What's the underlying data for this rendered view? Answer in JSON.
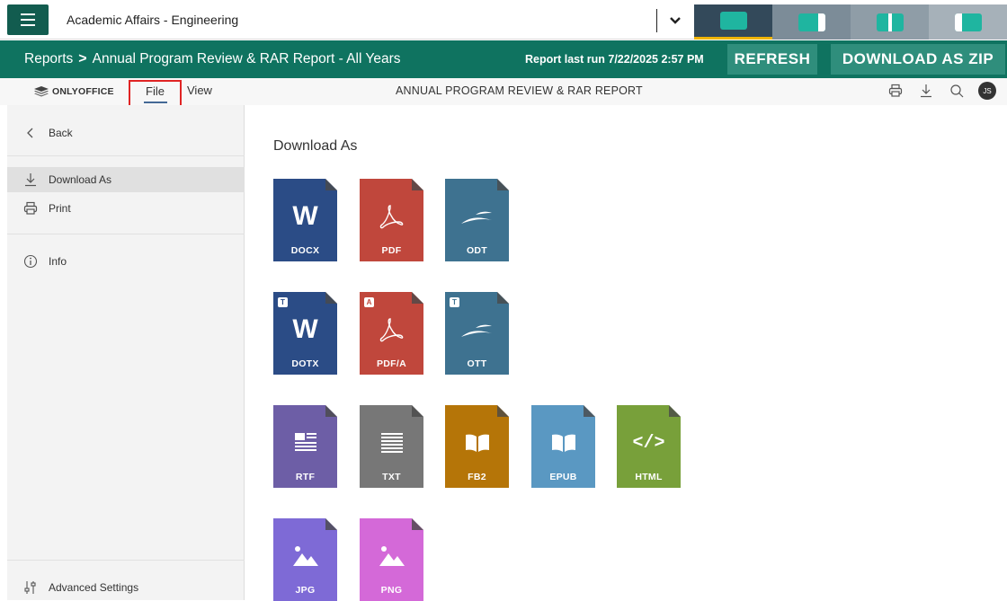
{
  "topbar": {
    "org_name": "Academic Affairs - Engineering",
    "dropdown_icon": "chevron-down-icon",
    "layout_tabs": [
      "layout-full-icon",
      "layout-split-1-icon",
      "layout-split-2-icon",
      "layout-split-3-icon"
    ]
  },
  "reportbar": {
    "breadcrumb_root": "Reports",
    "breadcrumb_separator": ">",
    "breadcrumb_current": "Annual Program Review & RAR Report - All Years",
    "last_run": "Report last run 7/22/2025 2:57 PM",
    "refresh_label": "REFRESH",
    "download_zip_label": "DOWNLOAD AS ZIP"
  },
  "editor": {
    "logo_text": "ONLYOFFICE",
    "tabs": [
      {
        "label": "File"
      },
      {
        "label": "View"
      }
    ],
    "doc_title": "ANNUAL PROGRAM REVIEW & RAR REPORT",
    "avatar_initials": "JS"
  },
  "file_menu": {
    "items": [
      {
        "label": "Back",
        "icon": "chevron-left-icon"
      },
      {
        "label": "Download As",
        "icon": "download-icon"
      },
      {
        "label": "Print",
        "icon": "printer-icon"
      },
      {
        "label": "Info",
        "icon": "info-icon"
      },
      {
        "label": "Advanced Settings",
        "icon": "sliders-icon"
      }
    ]
  },
  "download": {
    "title": "Download As",
    "formats": [
      {
        "label": "DOCX",
        "color": "#2b4c86"
      },
      {
        "label": "PDF",
        "color": "#c0473c"
      },
      {
        "label": "ODT",
        "color": "#3e7290"
      },
      {
        "label": "DOTX",
        "color": "#2b4c86",
        "badge": "T"
      },
      {
        "label": "PDF/A",
        "color": "#c0473c",
        "badge": "A"
      },
      {
        "label": "OTT",
        "color": "#3e7290",
        "badge": "T"
      },
      {
        "label": "RTF",
        "color": "#6d5ea6"
      },
      {
        "label": "TXT",
        "color": "#777777"
      },
      {
        "label": "FB2",
        "color": "#b57508"
      },
      {
        "label": "EPUB",
        "color": "#5a98c2"
      },
      {
        "label": "HTML",
        "color": "#78a03a"
      },
      {
        "label": "JPG",
        "color": "#7e6ad6"
      },
      {
        "label": "PNG",
        "color": "#d469d8"
      }
    ]
  }
}
